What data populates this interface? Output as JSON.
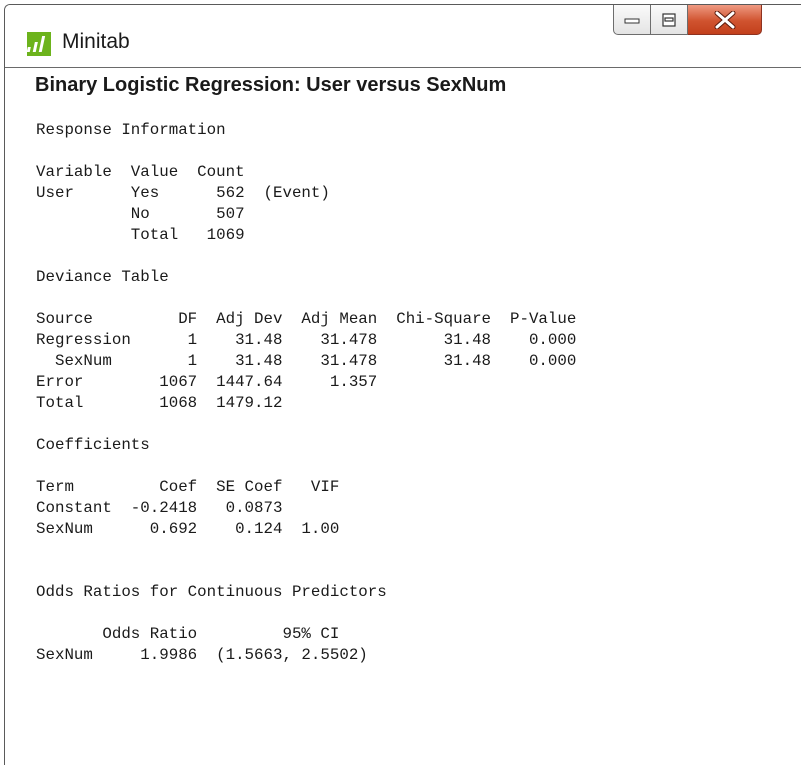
{
  "window": {
    "app_title": "Minitab",
    "icon": "minitab-logo-icon",
    "accent_color": "#6cb31c",
    "close_color": "#d0532f"
  },
  "output": {
    "title": "Binary Logistic Regression: User versus SexNum",
    "lines": [
      "Response Information",
      "",
      "Variable  Value  Count",
      "User      Yes      562  (Event)",
      "          No       507",
      "          Total   1069",
      "",
      "Deviance Table",
      "",
      "Source         DF  Adj Dev  Adj Mean  Chi-Square  P-Value",
      "Regression      1    31.48    31.478       31.48    0.000",
      "  SexNum        1    31.48    31.478       31.48    0.000",
      "Error        1067  1447.64     1.357",
      "Total        1068  1479.12",
      "",
      "Coefficients",
      "",
      "Term         Coef  SE Coef   VIF",
      "Constant  -0.2418   0.0873",
      "SexNum      0.692    0.124  1.00",
      "",
      "",
      "Odds Ratios for Continuous Predictors",
      "",
      "       Odds Ratio         95% CI",
      "SexNum     1.9986  (1.5663, 2.5502)"
    ]
  }
}
